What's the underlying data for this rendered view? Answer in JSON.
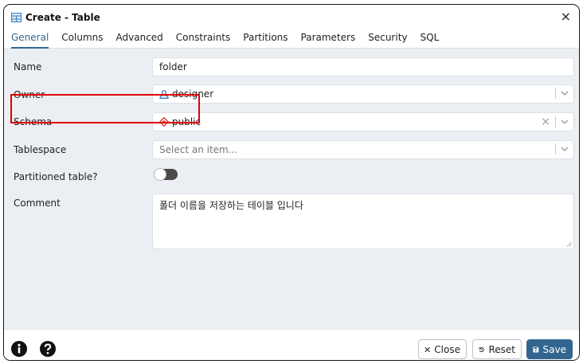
{
  "window": {
    "title": "Create - Table",
    "close_glyph": "×"
  },
  "tabs": [
    {
      "label": "General",
      "active": true
    },
    {
      "label": "Columns"
    },
    {
      "label": "Advanced"
    },
    {
      "label": "Constraints"
    },
    {
      "label": "Partitions"
    },
    {
      "label": "Parameters"
    },
    {
      "label": "Security"
    },
    {
      "label": "SQL"
    }
  ],
  "form": {
    "name": {
      "label": "Name",
      "value": "folder"
    },
    "owner": {
      "label": "Owner",
      "value": "designer",
      "icon": "user-icon"
    },
    "schema": {
      "label": "Schema",
      "value": "public",
      "icon": "schema-icon",
      "clear_glyph": "×"
    },
    "tablespace": {
      "label": "Tablespace",
      "placeholder": "Select an item..."
    },
    "partitioned": {
      "label": "Partitioned table?",
      "on": false
    },
    "comment": {
      "label": "Comment",
      "value": "폴더 이름을 저장하는 테이블 입니다"
    }
  },
  "footer": {
    "info_icon": "info-icon",
    "help_icon": "help-icon",
    "close_label": "Close",
    "reset_label": "Reset",
    "save_label": "Save"
  },
  "colors": {
    "accent": "#326690",
    "highlight": "#e00000",
    "body_bg": "#ebeef3"
  }
}
